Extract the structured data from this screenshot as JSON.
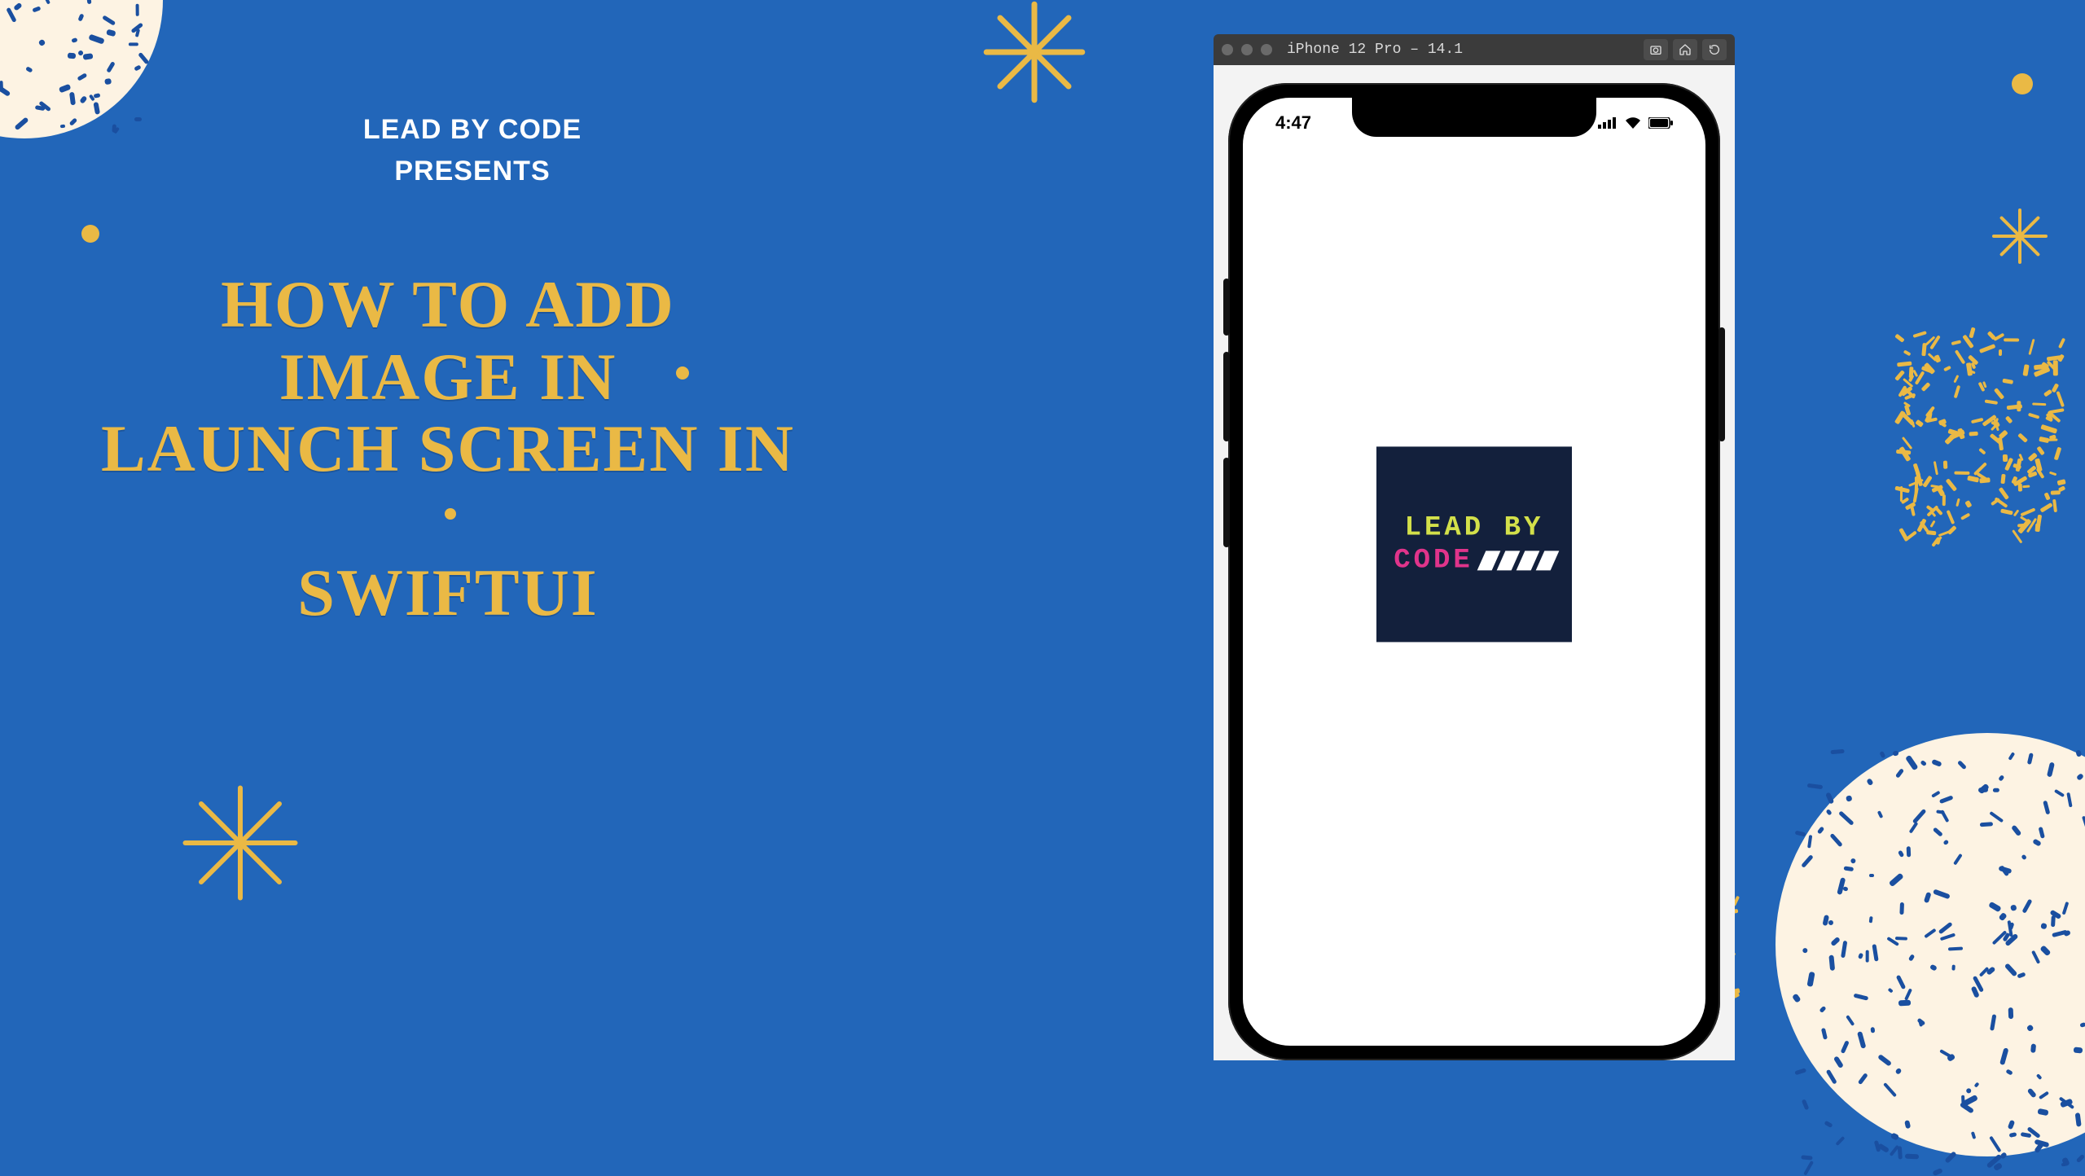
{
  "presenter": {
    "line1": "LEAD BY CODE",
    "line2": "PRESENTS"
  },
  "headline": {
    "line1": "HOW TO ADD IMAGE IN",
    "line2": "LAUNCH SCREEN IN",
    "line3": "SWIFTUI"
  },
  "simulator": {
    "device_label": "iPhone 12 Pro – 14.1",
    "toolbar_icons": [
      "screenshot",
      "home",
      "rotate"
    ]
  },
  "phone": {
    "clock": "4:47",
    "status": {
      "signal": 4,
      "wifi": true,
      "battery_pct": 100
    }
  },
  "launch_logo": {
    "line1": "LEAD BY",
    "line2": "CODE",
    "slash_count": 4
  },
  "palette": {
    "bg": "#2266b9",
    "accent": "#eab945",
    "cream": "#fdf3e3",
    "navy": "#13203c"
  }
}
